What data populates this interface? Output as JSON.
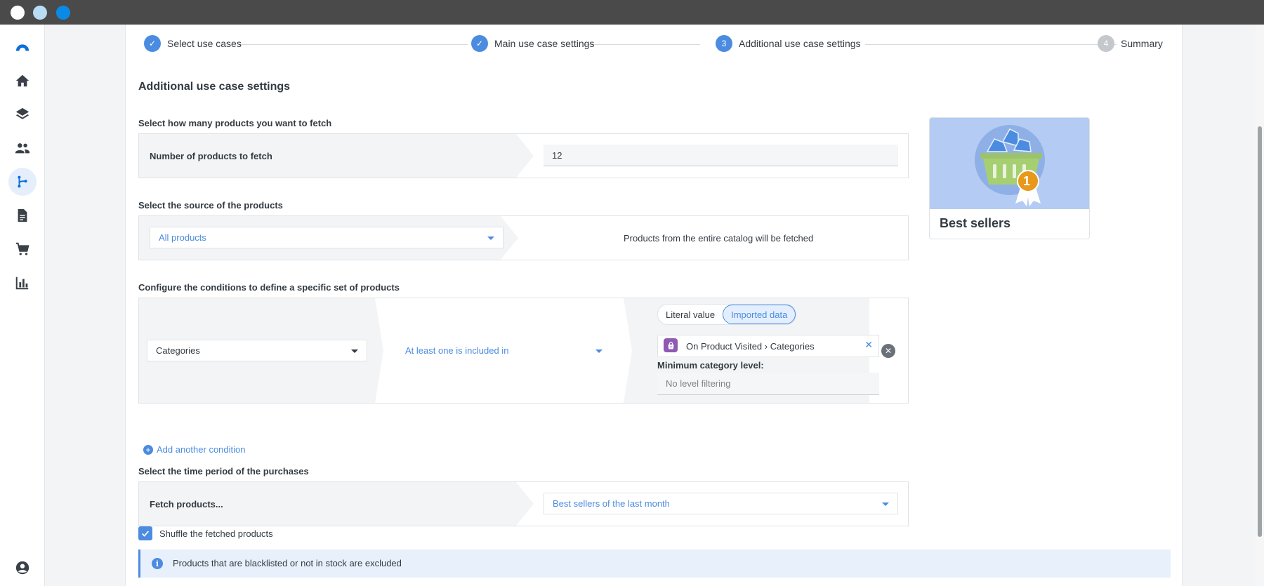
{
  "window": {
    "controls": [
      "close",
      "minimize",
      "maximize"
    ]
  },
  "sidebar": {
    "items": [
      {
        "icon": "logo-icon"
      },
      {
        "icon": "home-icon"
      },
      {
        "icon": "layers-icon"
      },
      {
        "icon": "people-icon"
      },
      {
        "icon": "scenario-icon",
        "active": true
      },
      {
        "icon": "document-icon"
      },
      {
        "icon": "cart-icon"
      },
      {
        "icon": "chart-icon"
      },
      {
        "icon": "account-icon"
      }
    ]
  },
  "stepper": {
    "steps": [
      {
        "number": "1",
        "label": "Select use cases",
        "state": "done"
      },
      {
        "number": "2",
        "label": "Main use case settings",
        "state": "done"
      },
      {
        "number": "3",
        "label": "Additional use case settings",
        "state": "current"
      },
      {
        "number": "4",
        "label": "Summary",
        "state": "todo"
      }
    ]
  },
  "page": {
    "title": "Additional use case settings",
    "products_count": {
      "label": "Select how many products you want to fetch",
      "field_label": "Number of products to fetch",
      "value": "12"
    },
    "source": {
      "label": "Select the source of the products",
      "selected": "All products",
      "description": "Products from the entire catalog will be fetched"
    },
    "conditions": {
      "label": "Configure the conditions to define a specific set of products",
      "attribute": "Categories",
      "operator": "At least one is included in",
      "toggle_literal": "Literal value",
      "toggle_imported": "Imported data",
      "imported_value": "On Product Visited › Categories",
      "min_level_label": "Minimum category level:",
      "min_level_placeholder": "No level filtering",
      "add_label": "Add another condition"
    },
    "time_period": {
      "label": "Select the time period of the purchases",
      "field_label": "Fetch products...",
      "selected": "Best sellers of the last month"
    },
    "shuffle": {
      "label": "Shuffle the fetched products",
      "checked": true
    },
    "info": "Products that are blacklisted or not in stock are excluded"
  },
  "card": {
    "title": "Best sellers",
    "badge": "1"
  },
  "colors": {
    "accent": "#4b8ce0",
    "card_bg": "#b4ccf3",
    "badge": "#e8981a"
  }
}
